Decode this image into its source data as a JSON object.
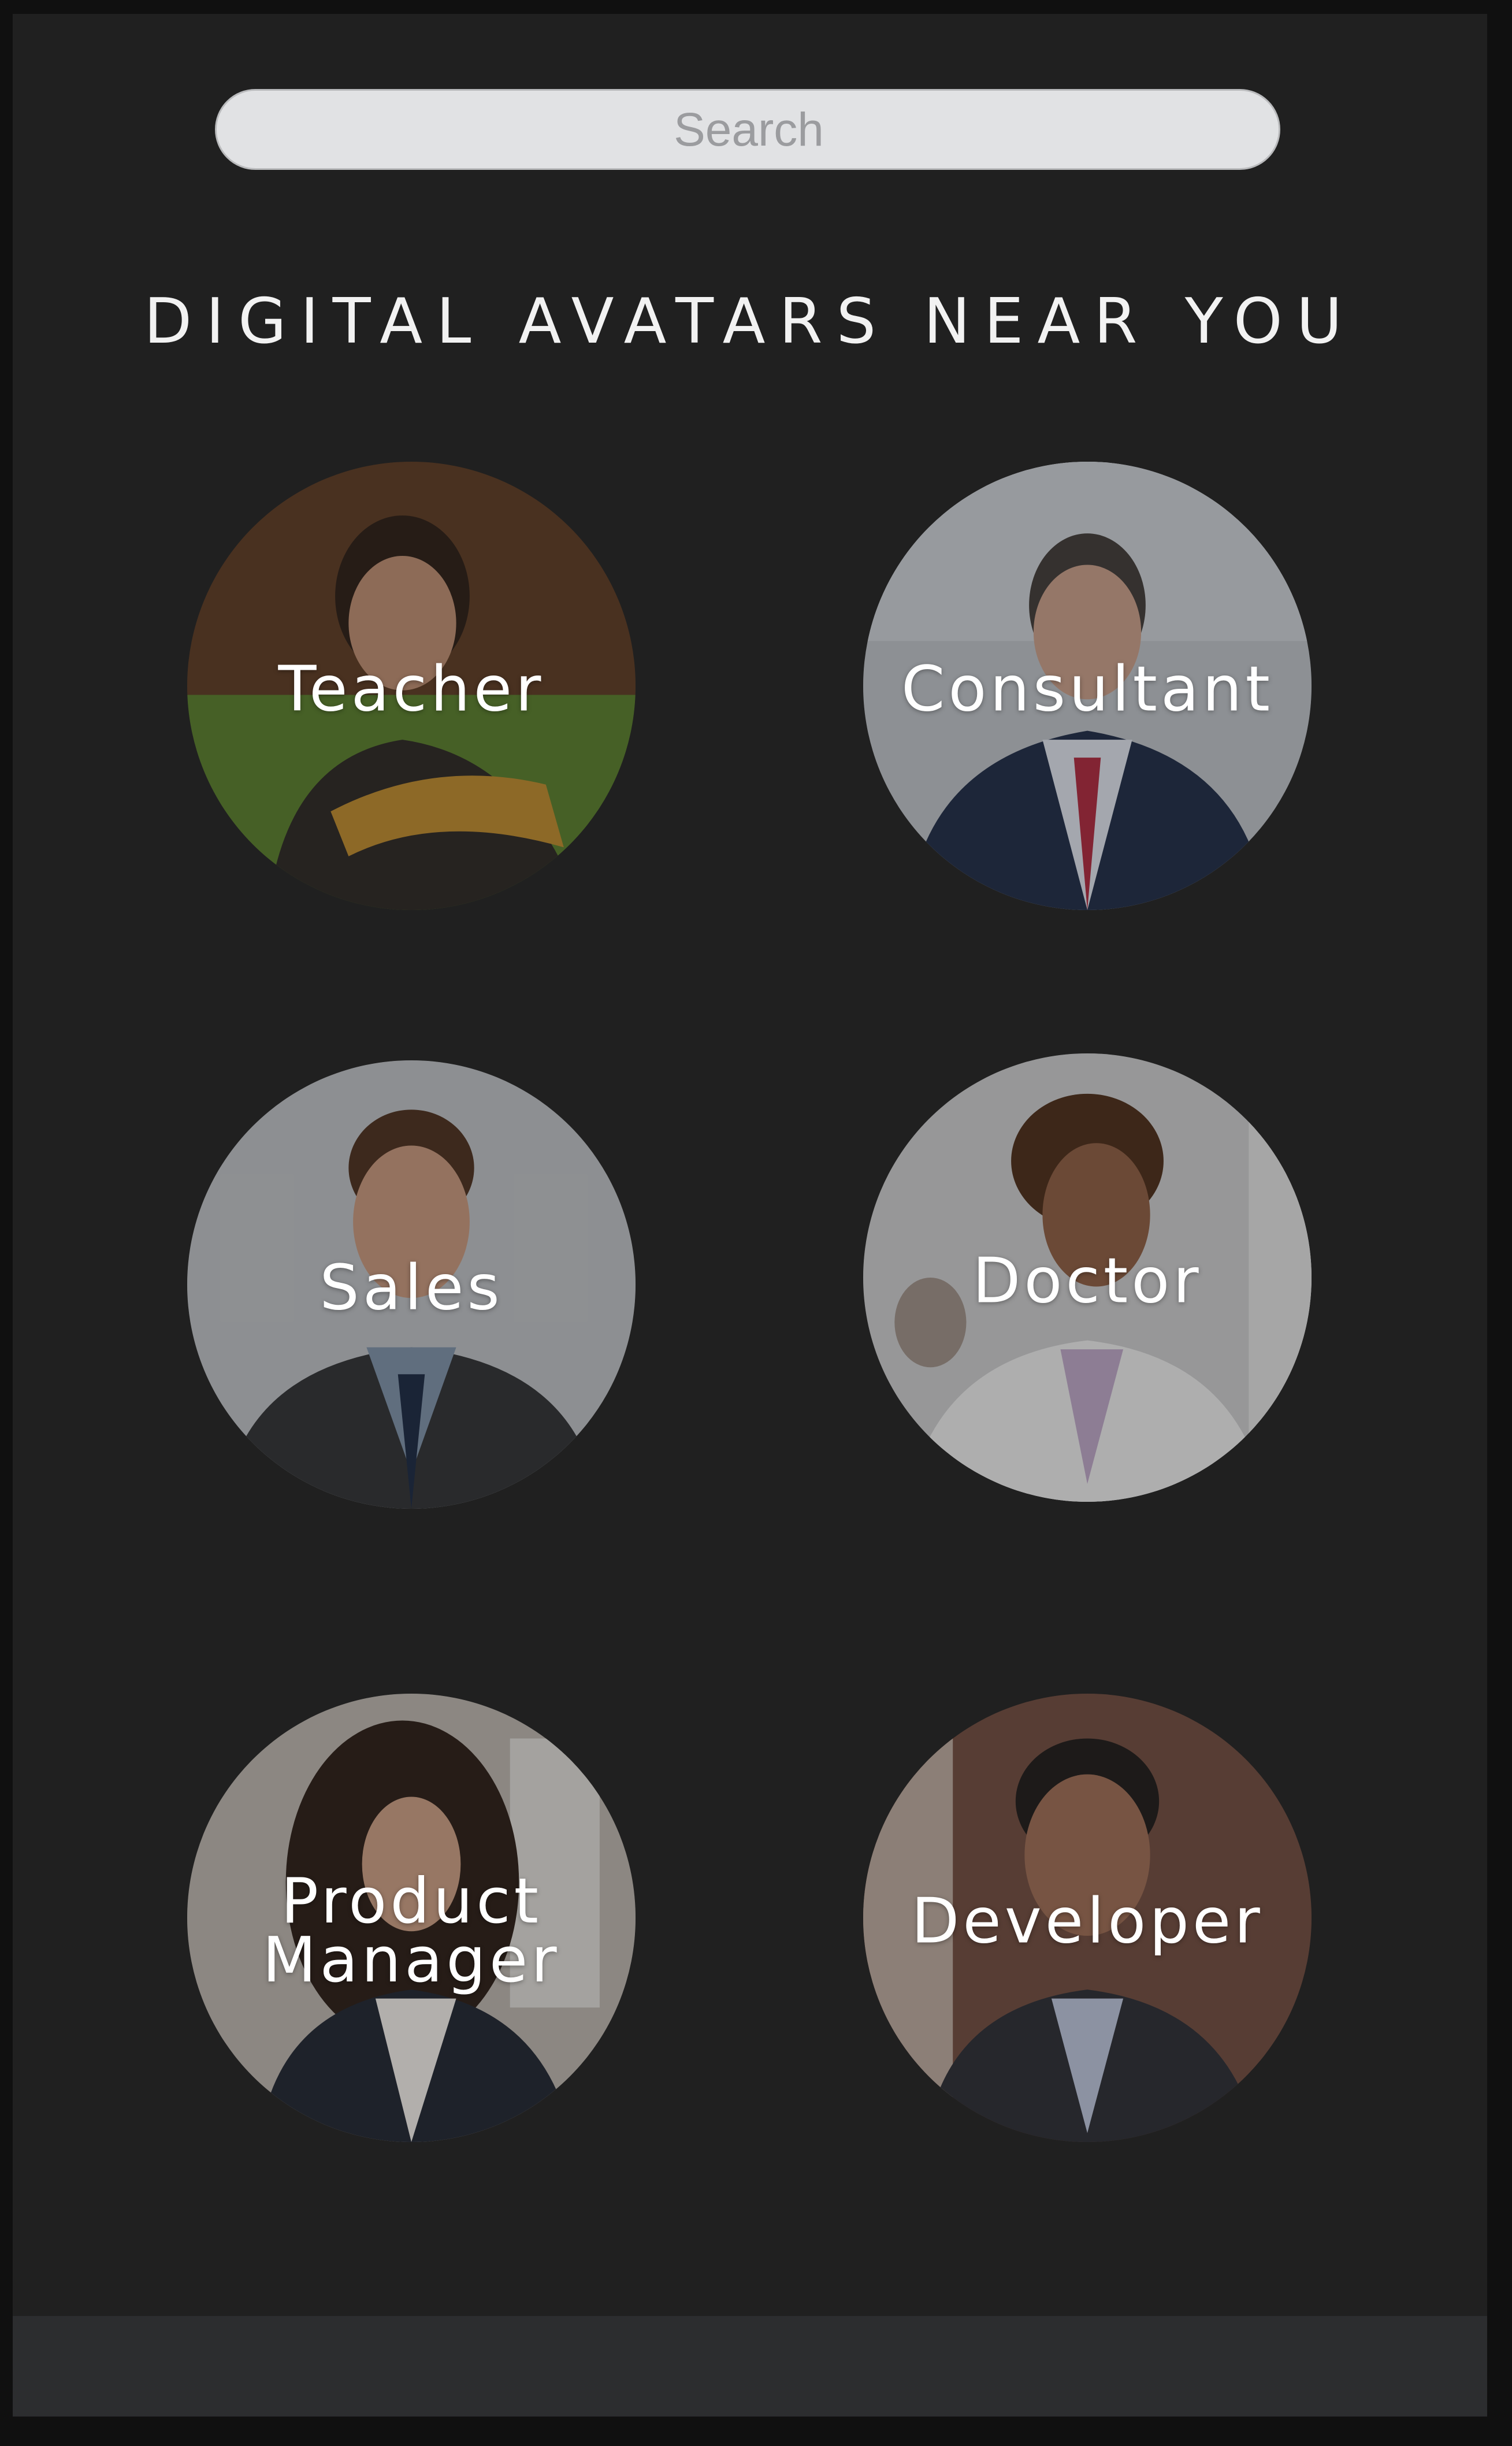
{
  "search": {
    "placeholder": "Search"
  },
  "header": {
    "title": "DIGITAL AVATARS NEAR YOU"
  },
  "avatars": [
    {
      "label": "Teacher"
    },
    {
      "label": "Consultant"
    },
    {
      "label": "Sales"
    },
    {
      "label": "Doctor"
    },
    {
      "label_line1": "Product",
      "label_line2": "Manager"
    },
    {
      "label": "Developer"
    }
  ],
  "colors": {
    "background": "#202020",
    "search_bg": "#e1e2e4",
    "title_text": "#f2f2f2",
    "footer": "#2c2d2f"
  }
}
